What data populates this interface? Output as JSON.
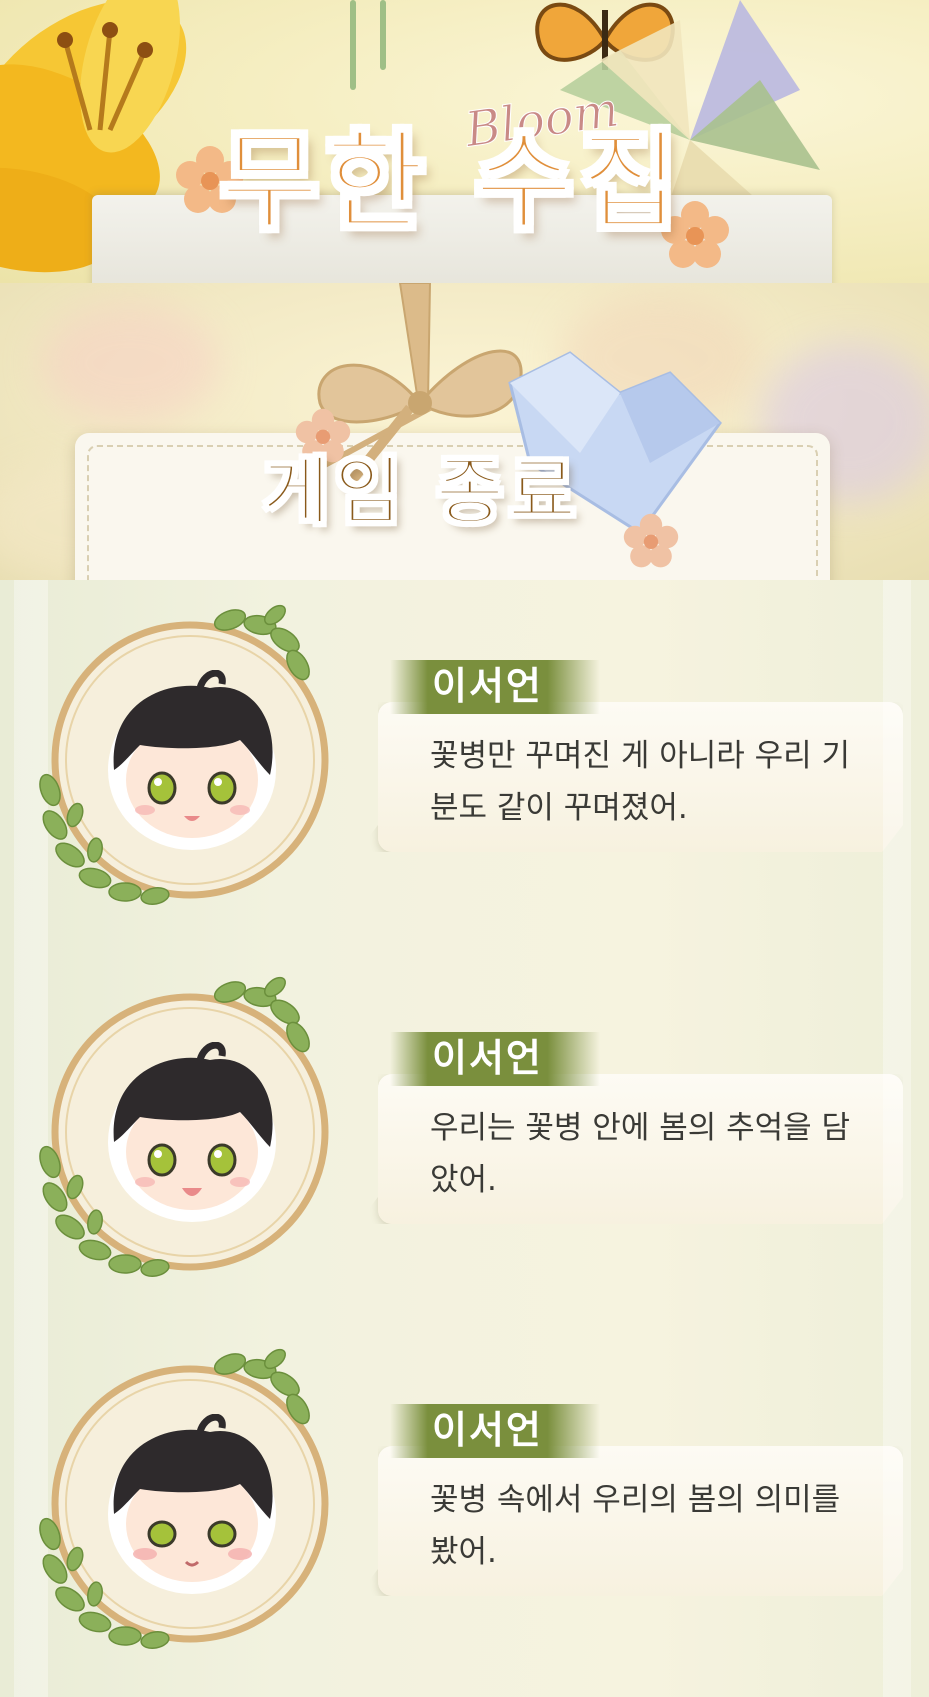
{
  "header": {
    "title": "무한 수집",
    "subtitle": "Bloom"
  },
  "banner": {
    "title": "게임 종료"
  },
  "dialogues": [
    {
      "speaker": "이서언",
      "text": "꽃병만 꾸며진 게 아니라 우리 기분도 같이 꾸며졌어."
    },
    {
      "speaker": "이서언",
      "text": "우리는 꽃병 안에 봄의 추억을 담았어."
    },
    {
      "speaker": "이서언",
      "text": "꽃병 속에서 우리의 봄의 의미를 봤어."
    }
  ],
  "colors": {
    "title_orange": "#e08f3b",
    "gameover_brown": "#8a5a1b",
    "name_tag_green": "#7a8f3d",
    "leaf_green": "#8bb05a",
    "wreath_gold": "#d7b27a",
    "hair_dark": "#2e2a2c",
    "eye_green": "#a5c23a"
  }
}
